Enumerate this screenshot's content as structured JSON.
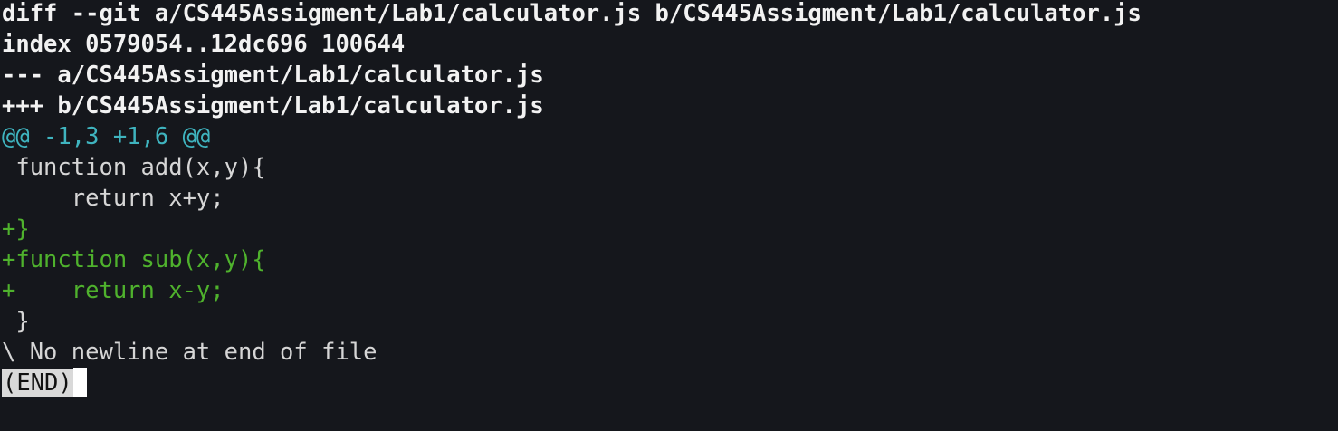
{
  "terminal": {
    "lines": [
      {
        "type": "meta",
        "text": "diff --git a/CS445Assigment/Lab1/calculator.js b/CS445Assigment/Lab1/calculator.js"
      },
      {
        "type": "meta",
        "text": "index 0579054..12dc696 100644"
      },
      {
        "type": "meta",
        "text": "--- a/CS445Assigment/Lab1/calculator.js"
      },
      {
        "type": "meta",
        "text": "+++ b/CS445Assigment/Lab1/calculator.js"
      },
      {
        "type": "hunk",
        "text": "@@ -1,3 +1,6 @@"
      },
      {
        "type": "ctx",
        "text": " function add(x,y){"
      },
      {
        "type": "ctx",
        "text": "     return x+y;"
      },
      {
        "type": "add",
        "text": "+}"
      },
      {
        "type": "add",
        "text": "+function sub(x,y){"
      },
      {
        "type": "add",
        "text": "+    return x-y;"
      },
      {
        "type": "ctx",
        "text": " }"
      },
      {
        "type": "note",
        "text": "\\ No newline at end of file"
      }
    ],
    "pager_status": "(END)",
    "colors": {
      "background": "#15171c",
      "meta": "#f2f2f2",
      "hunk": "#3fb4bf",
      "context": "#d6d6d6",
      "added": "#4fb22d",
      "cursor": "#ffffff"
    }
  }
}
